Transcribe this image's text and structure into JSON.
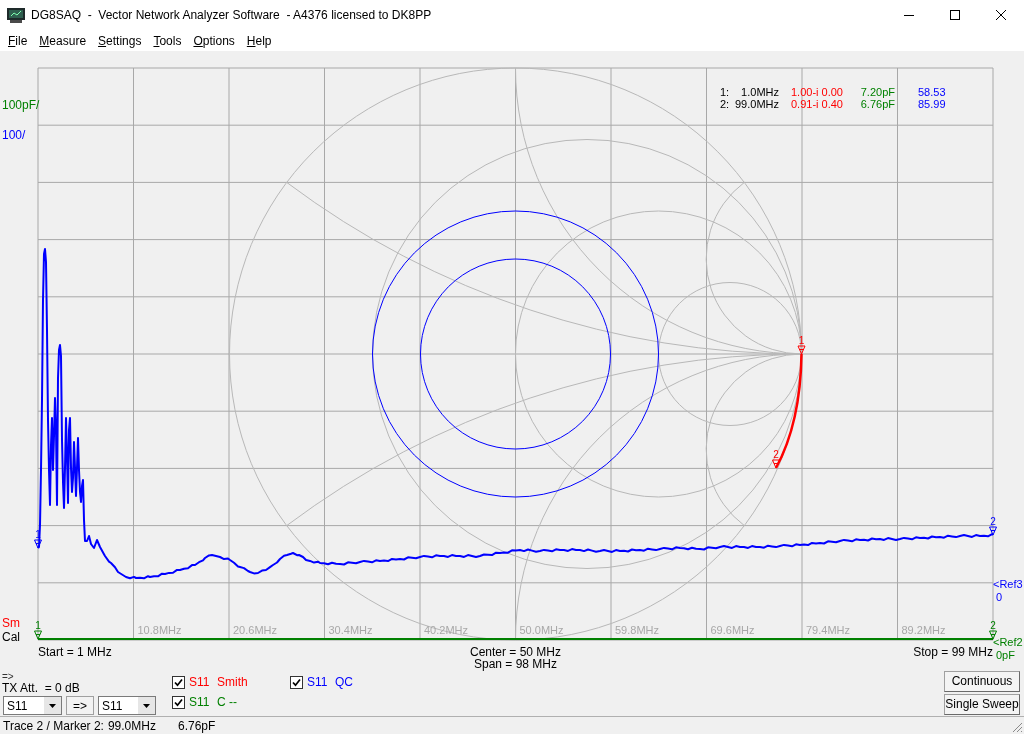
{
  "window": {
    "title": "DG8SAQ  -  Vector Network Analyzer Software  - A4376 licensed to DK8PP"
  },
  "menu": [
    "File",
    "Measure",
    "Settings",
    "Tools",
    "Options",
    "Help"
  ],
  "plot": {
    "scales": [
      {
        "text": "100pF/",
        "color": "#008000"
      },
      {
        "text": "100/",
        "color": "#0000ff"
      }
    ],
    "marker_readouts": [
      {
        "index": "1:",
        "frequency": "1.0MHz",
        "values": [
          "1.00-i 0.00",
          "7.20pF",
          "58.53"
        ]
      },
      {
        "index": "2:",
        "frequency": "99.0MHz",
        "values": [
          "0.91-i 0.40",
          "6.76pF",
          "85.99"
        ]
      }
    ],
    "references": [
      {
        "name": "<Ref3",
        "value": "0",
        "color": "#0000ff"
      },
      {
        "name": "<Ref2",
        "value": "0pF",
        "color": "#008000"
      }
    ],
    "indicators": [
      {
        "text": "Sm",
        "color": "#ff0000"
      },
      {
        "text": "Cal",
        "color": "#000000"
      }
    ],
    "frequency_labels": [
      "10.8MHz",
      "20.6MHz",
      "30.4MHz",
      "40.2MHz",
      "50.0MHz",
      "59.8MHz",
      "69.6MHz",
      "79.4MHz",
      "89.2MHz"
    ]
  },
  "sweep": {
    "start": "Start = 1 MHz",
    "center": "Center = 50 MHz",
    "span": "Span = 98 MHz",
    "stop": "Stop = 99 MHz"
  },
  "controls": {
    "indicator": "=>",
    "tx_attenuation": "TX Att.  = 0 dB",
    "source_select": "S11",
    "transfer_button": "=>",
    "target_select": "S11"
  },
  "traces": [
    {
      "kind": "smith",
      "parameter": "S11",
      "format": "Smith",
      "color": "#ff0000",
      "checked": true,
      "markers": [
        "1",
        "2"
      ]
    },
    {
      "kind": "capacitance",
      "parameter": "S11",
      "format": "C --",
      "color": "#008000",
      "checked": true,
      "markers": [
        "1",
        "2"
      ]
    },
    {
      "kind": "quality",
      "parameter": "S11",
      "format": "QC",
      "color": "#0000ff",
      "checked": true,
      "markers": [
        "1",
        "2"
      ]
    }
  ],
  "buttons": [
    "Continuous",
    "Single Sweep"
  ],
  "status_bar": {
    "trace_marker": "Trace 2 / Marker 2:",
    "frequency": "99.0MHz",
    "value": "6.76pF"
  }
}
